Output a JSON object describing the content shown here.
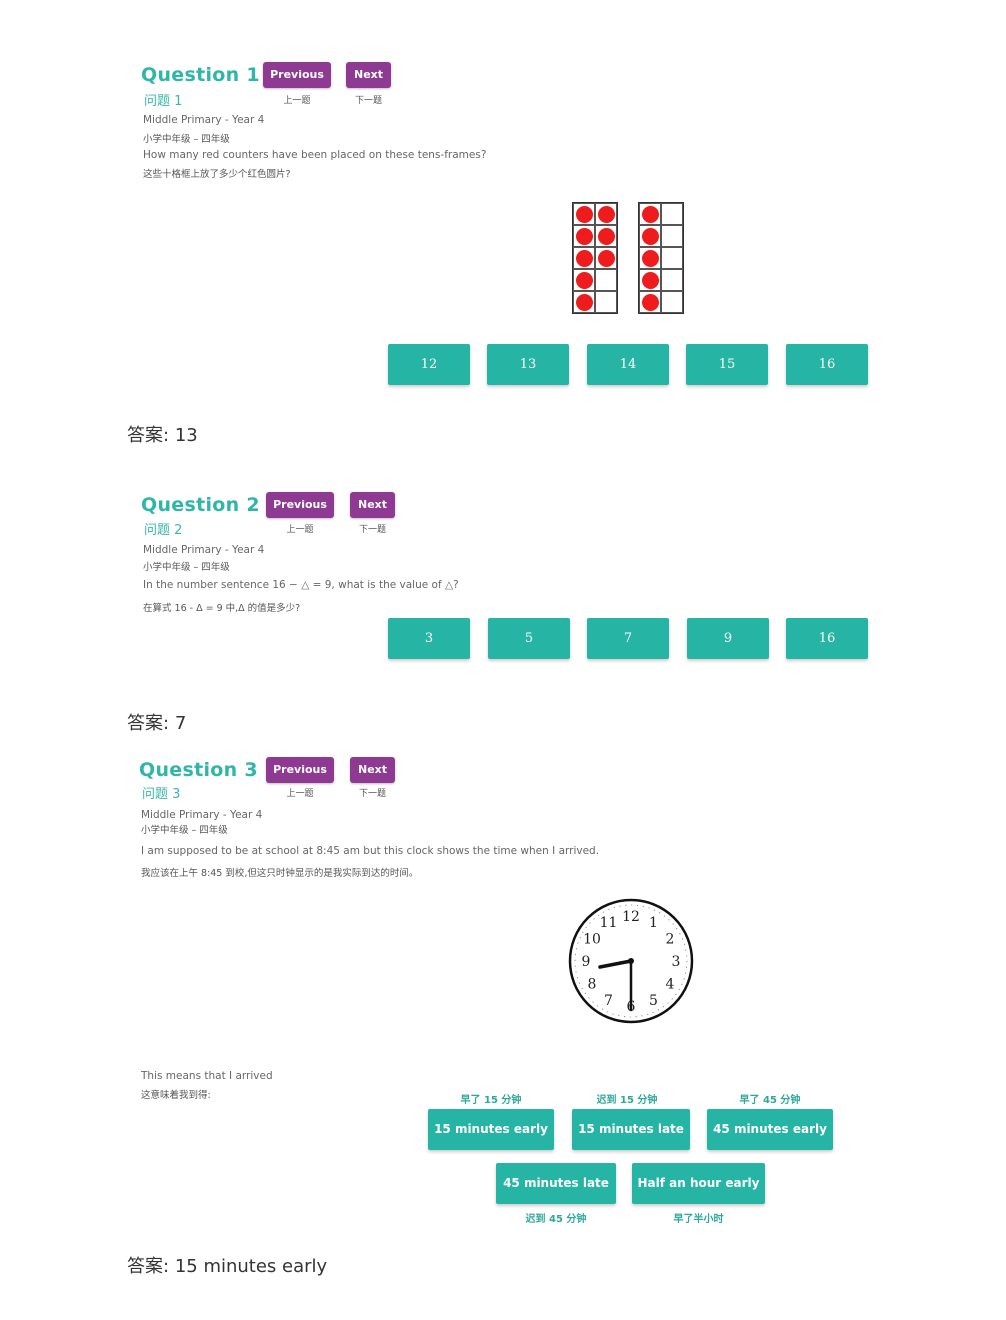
{
  "questions": [
    {
      "title": "Question 1",
      "title_cn": "问题 1",
      "prev": "Previous",
      "prev_cn": "上一题",
      "next": "Next",
      "next_cn": "下一题",
      "level": "Middle Primary - Year 4",
      "level_cn": "小学中年级 – 四年级",
      "text": "How many red counters have been placed on these tens-frames?",
      "text_cn": "这些十格框上放了多少个红色圆片?",
      "options": [
        "12",
        "13",
        "14",
        "15",
        "16"
      ],
      "answer_label": "答案:",
      "answer": "13",
      "tens_frames": [
        {
          "filled": 8
        },
        {
          "filled": 5
        }
      ]
    },
    {
      "title": "Question 2",
      "title_cn": "问题 2",
      "prev": "Previous",
      "prev_cn": "上一题",
      "next": "Next",
      "next_cn": "下一题",
      "level": "Middle Primary - Year 4",
      "level_cn": "小学中年级 – 四年级",
      "text": "In the number sentence 16 − △ = 9, what is the value of △?",
      "text_cn": "在算式 16 - Δ = 9 中,Δ 的值是多少?",
      "options": [
        "3",
        "5",
        "7",
        "9",
        "16"
      ],
      "answer_label": "答案:",
      "answer": "7"
    },
    {
      "title": "Question 3",
      "title_cn": "问题 3",
      "prev": "Previous",
      "prev_cn": "上一题",
      "next": "Next",
      "next_cn": "下一题",
      "level": "Middle Primary - Year 4",
      "level_cn": "小学中年级 – 四年级",
      "text": "I am supposed to be at school at 8:45 am but this clock shows the time when I arrived.",
      "text_cn": "我应该在上午 8:45 到校,但这只时钟显示的是我实际到达的时间。",
      "clock": {
        "numbers": [
          "12",
          "1",
          "2",
          "3",
          "4",
          "5",
          "6",
          "7",
          "8",
          "9",
          "10",
          "11"
        ],
        "time": "8:30"
      },
      "prompt": "This means that I arrived",
      "prompt_cn": "这意味着我到得:",
      "options": [
        {
          "label": "15 minutes early",
          "cn": "早了 15 分钟"
        },
        {
          "label": "15 minutes late",
          "cn": "迟到 15 分钟"
        },
        {
          "label": "45 minutes early",
          "cn": "早了 45 分钟"
        },
        {
          "label": "45 minutes late",
          "cn": "迟到 45 分钟"
        },
        {
          "label": "Half an hour early",
          "cn": "早了半小时"
        }
      ],
      "answer_label": "答案:",
      "answer": "15 minutes early"
    }
  ]
}
